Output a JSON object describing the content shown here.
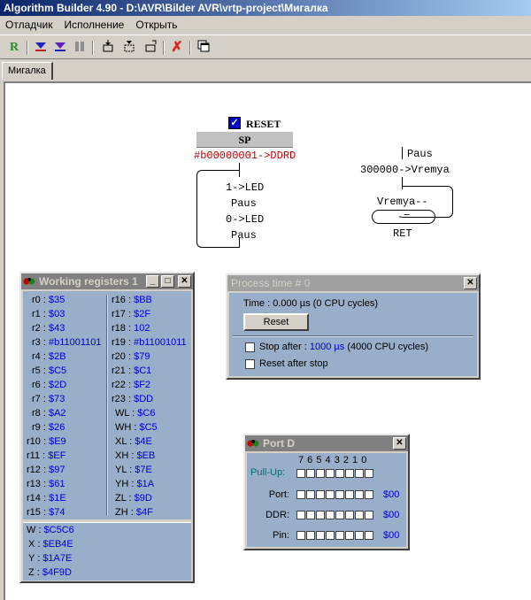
{
  "app": {
    "title": "Algorithm Builder 4.90 - D:\\AVR\\Bilder AVR\\vrtp-project\\Мигалка"
  },
  "menu": [
    "Отладчик",
    "Исполнение",
    "Открыть"
  ],
  "toolbar_icons": [
    "r-icon",
    "step-into-icon",
    "step-over-icon",
    "pause-icon",
    "trace-icon",
    "run-to-icon",
    "run-icon",
    "stop-icon",
    "windows-icon"
  ],
  "tab": {
    "label": "Мигалка"
  },
  "program": {
    "reset_label": "RESET",
    "sp_label": "SP",
    "init": "#b00000001->DDRD",
    "ops": [
      "1->LED",
      "Paus",
      "0->LED",
      "Paus"
    ],
    "sub_name": "Paus",
    "sub_init": "300000->Vremya",
    "sub_loop": "Vremya--",
    "sub_cond": "-=",
    "sub_ret": "RET"
  },
  "registers": {
    "title": "Working registers 1",
    "left": [
      [
        "r0",
        "$35"
      ],
      [
        "r1",
        "$03"
      ],
      [
        "r2",
        "$43"
      ],
      [
        "r3",
        "#b11001101"
      ],
      [
        "r4",
        "$2B"
      ],
      [
        "r5",
        "$C5"
      ],
      [
        "r6",
        "$2D"
      ],
      [
        "r7",
        "$73"
      ],
      [
        "r8",
        "$A2"
      ],
      [
        "r9",
        "$26"
      ],
      [
        "r10",
        "$E9"
      ],
      [
        "r11",
        "$EF"
      ],
      [
        "r12",
        "$97"
      ],
      [
        "r13",
        "$61"
      ],
      [
        "r14",
        "$1E"
      ],
      [
        "r15",
        "$74"
      ]
    ],
    "right": [
      [
        "r16",
        "$BB"
      ],
      [
        "r17",
        "$2F"
      ],
      [
        "r18",
        "102"
      ],
      [
        "r19",
        "#b11001011"
      ],
      [
        "r20",
        "$79"
      ],
      [
        "r21",
        "$C1"
      ],
      [
        "r22",
        "$F2"
      ],
      [
        "r23",
        "$DD"
      ],
      [
        "WL",
        "$C6"
      ],
      [
        "WH",
        "$C5"
      ],
      [
        "XL",
        "$4E"
      ],
      [
        "XH",
        "$EB"
      ],
      [
        "YL",
        "$7E"
      ],
      [
        "YH",
        "$1A"
      ],
      [
        "ZL",
        "$9D"
      ],
      [
        "ZH",
        "$4F"
      ]
    ],
    "pairs": [
      [
        "W",
        "$C5C6"
      ],
      [
        "X",
        "$EB4E"
      ],
      [
        "Y",
        "$1A7E"
      ],
      [
        "Z",
        "$4F9D"
      ]
    ]
  },
  "process": {
    "title": "Process time # 0",
    "time_label": "Time :  0.000 µs (0 CPU cycles)",
    "reset_button": "Reset",
    "stop_label": "Stop after :",
    "stop_value": "1000 µs",
    "stop_cycles": "(4000 CPU cycles)",
    "reset_after_stop": "Reset after stop"
  },
  "port": {
    "title": "Port D",
    "bits": "7 6 5 4 3 2 1 0",
    "pullup_label": "Pull-Up:",
    "rows": [
      {
        "label": "Port:",
        "value": "$00"
      },
      {
        "label": "DDR:",
        "value": "$00"
      },
      {
        "label": "Pin:",
        "value": "$00"
      }
    ]
  }
}
